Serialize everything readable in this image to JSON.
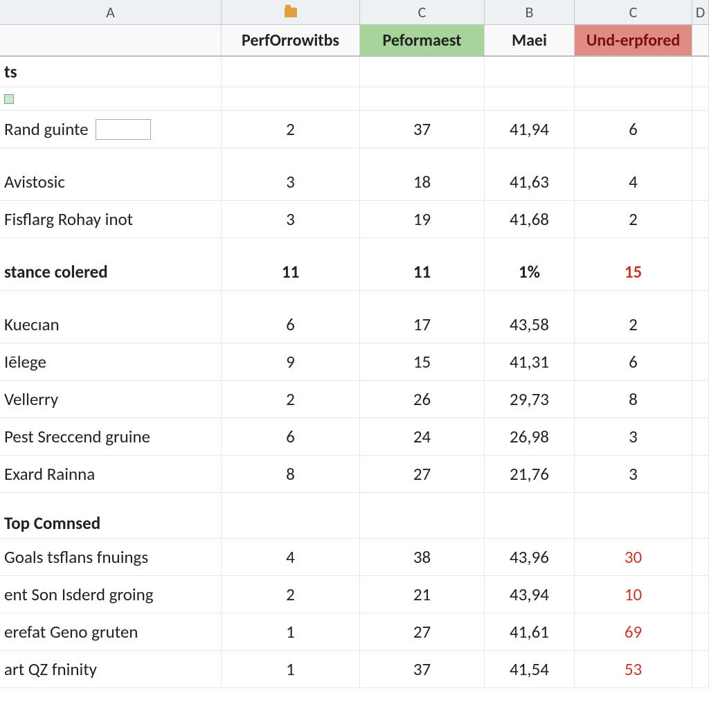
{
  "columns": {
    "letters": [
      "A",
      "",
      "C",
      "B",
      "C",
      "D"
    ],
    "fields": [
      "",
      "PerfOrrowitbs",
      "Peformaest",
      "Maei",
      "Und-erpfored",
      ""
    ]
  },
  "rows": [
    {
      "type": "section",
      "label": "ts"
    },
    {
      "type": "iconrow"
    },
    {
      "type": "data",
      "label": " Rand guinte",
      "hasInput": true,
      "c1": "2",
      "c2": "37",
      "c3": "41,94",
      "c4": "6",
      "c4red": false
    },
    {
      "type": "spacer"
    },
    {
      "type": "data",
      "label": "Avistosic",
      "c1": "3",
      "c2": "18",
      "c3": "41,63",
      "c4": "4",
      "c4red": false
    },
    {
      "type": "data",
      "label": "Fisflarg Rohay inot",
      "c1": "3",
      "c2": "19",
      "c3": "41,68",
      "c4": "2",
      "c4red": false
    },
    {
      "type": "spacer"
    },
    {
      "type": "section-data",
      "label": "stance colered",
      "c1": "11",
      "c2": "11",
      "c3": "1%",
      "c4": "15",
      "c4red": true
    },
    {
      "type": "spacer"
    },
    {
      "type": "data",
      "label": "Kuecıan",
      "c1": "6",
      "c2": "17",
      "c3": "43,58",
      "c4": "2",
      "c4red": false
    },
    {
      "type": "data",
      "label": "Iēlege",
      "c1": "9",
      "c2": "15",
      "c3": "41,31",
      "c4": "6",
      "c4red": false
    },
    {
      "type": "data",
      "label": "Vellerry",
      "c1": "2",
      "c2": "26",
      "c3": "29,73",
      "c4": "8",
      "c4red": false
    },
    {
      "type": "data",
      "label": "Pest Sreccend gruine",
      "c1": "6",
      "c2": "24",
      "c3": "26,98",
      "c4": "3",
      "c4red": false
    },
    {
      "type": "data",
      "label": "Exard Rainna",
      "c1": "8",
      "c2": "27",
      "c3": "21,76",
      "c4": "3",
      "c4red": false
    },
    {
      "type": "spacer"
    },
    {
      "type": "section",
      "label": "Top Comnsed"
    },
    {
      "type": "data",
      "label": "Goals tsflans fnuings",
      "c1": "4",
      "c2": "38",
      "c3": "43,96",
      "c4": "30",
      "c4red": true
    },
    {
      "type": "data",
      "label": "ent Son Isderd groing",
      "c1": "2",
      "c2": "21",
      "c3": "43,94",
      "c4": "10",
      "c4red": true
    },
    {
      "type": "data",
      "label": "erefat Geno gruten",
      "c1": "1",
      "c2": "27",
      "c3": "41,61",
      "c4": "69",
      "c4red": true
    },
    {
      "type": "data",
      "label": "art QZ fninity",
      "c1": "1",
      "c2": "37",
      "c3": "41,54",
      "c4": "53",
      "c4red": true
    }
  ]
}
